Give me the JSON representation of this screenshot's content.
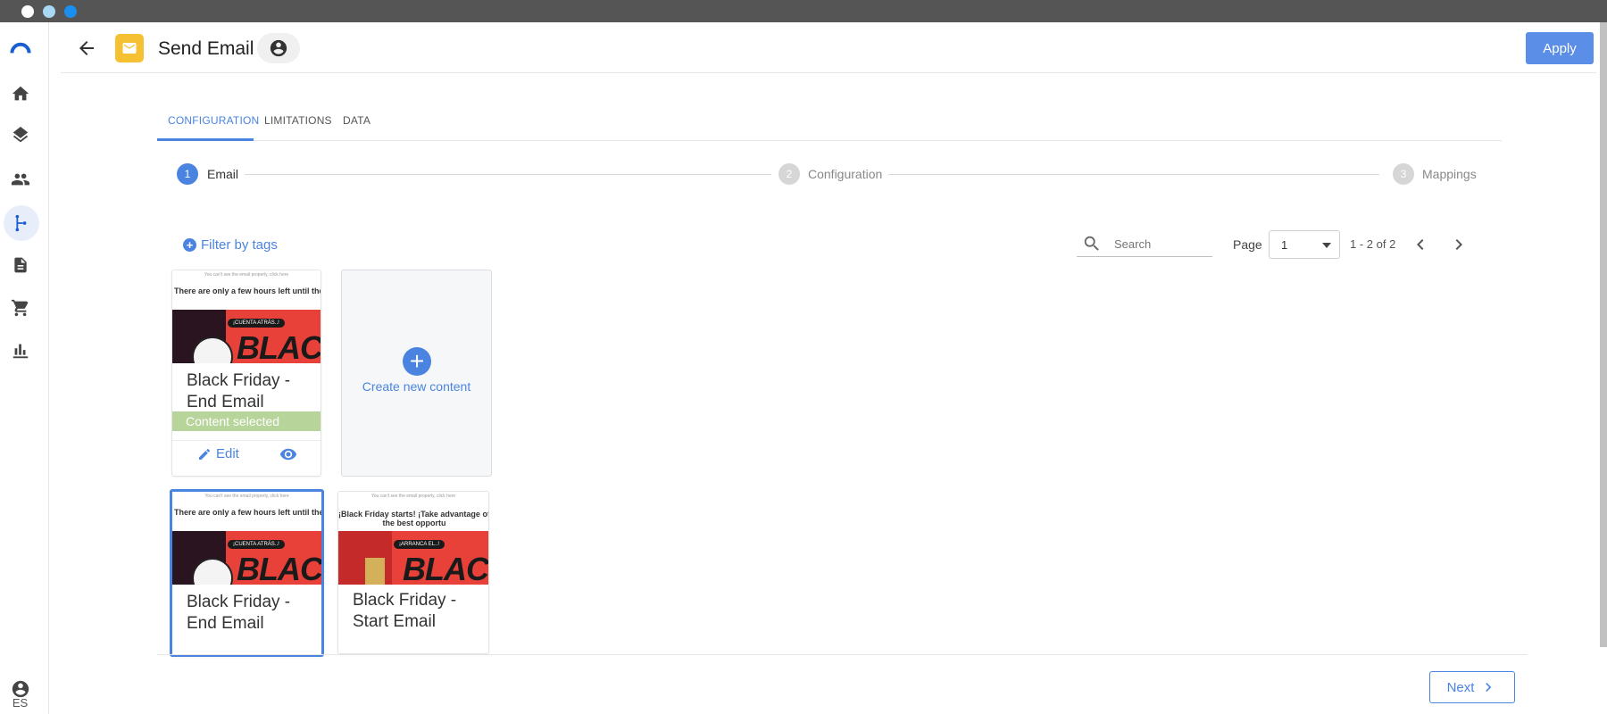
{
  "window": {
    "dot_colors": [
      "#ffffff",
      "#a9d8f5",
      "#1a8ff0"
    ]
  },
  "sidebar": {
    "items": [
      {
        "icon": "brand-logo-icon"
      },
      {
        "icon": "home-icon"
      },
      {
        "icon": "layers-icon"
      },
      {
        "icon": "people-icon"
      },
      {
        "icon": "flow-branch-icon",
        "active": true
      },
      {
        "icon": "document-icon"
      },
      {
        "icon": "cart-icon"
      },
      {
        "icon": "bar-chart-icon"
      }
    ],
    "user_icon": "account-circle-icon",
    "language": "ES"
  },
  "header": {
    "title": "Send Email",
    "apply_label": "Apply",
    "badge_color": "#f5c132"
  },
  "tabs": [
    {
      "label": "CONFIGURATION",
      "active": true
    },
    {
      "label": "LIMITATIONS",
      "active": false
    },
    {
      "label": "DATA",
      "active": false
    }
  ],
  "stepper": [
    {
      "number": "1",
      "label": "Email",
      "active": true
    },
    {
      "number": "2",
      "label": "Configuration",
      "active": false
    },
    {
      "number": "3",
      "label": "Mappings",
      "active": false
    }
  ],
  "toolbar": {
    "filter_label": "Filter by tags",
    "search_placeholder": "Search",
    "page_label": "Page",
    "page_value": "1",
    "range": "1 - 2 of 2"
  },
  "cards": [
    {
      "title": "Black Friday - End Email",
      "thumb_tiny": "You can't see the email properly, click here",
      "thumb_headline": "There are only a few hours left until the Black Friday, so don't miss out on any",
      "thumb_pill": "¡CUENTA ATRÁS..!",
      "thumb_big": "BLAC",
      "selected_label": "Content selected",
      "edit_label": "Edit"
    },
    {
      "title": "Black Friday - End Email",
      "thumb_tiny": "You can't see the email properly, click here",
      "thumb_headline": "There are only a few hours left until the Black Friday, so don't miss out on any",
      "thumb_pill": "¡CUENTA ATRÁS..!",
      "thumb_big": "BLAC"
    },
    {
      "title": "Black Friday - Start Email",
      "thumb_tiny": "You can't see the email properly, click here",
      "thumb_headline": "¡Black Friday starts! ¡Take advantage of the best opportu",
      "thumb_pill": "¡ARRANCA EL..!",
      "thumb_big": "BLAC"
    }
  ],
  "create_card": {
    "label": "Create new content"
  },
  "footer": {
    "next_label": "Next"
  },
  "colors": {
    "accent": "#4a84e0",
    "apply": "#5b8ee6",
    "selected_bar": "#b7d49a",
    "banner_red": "#e8413a"
  }
}
